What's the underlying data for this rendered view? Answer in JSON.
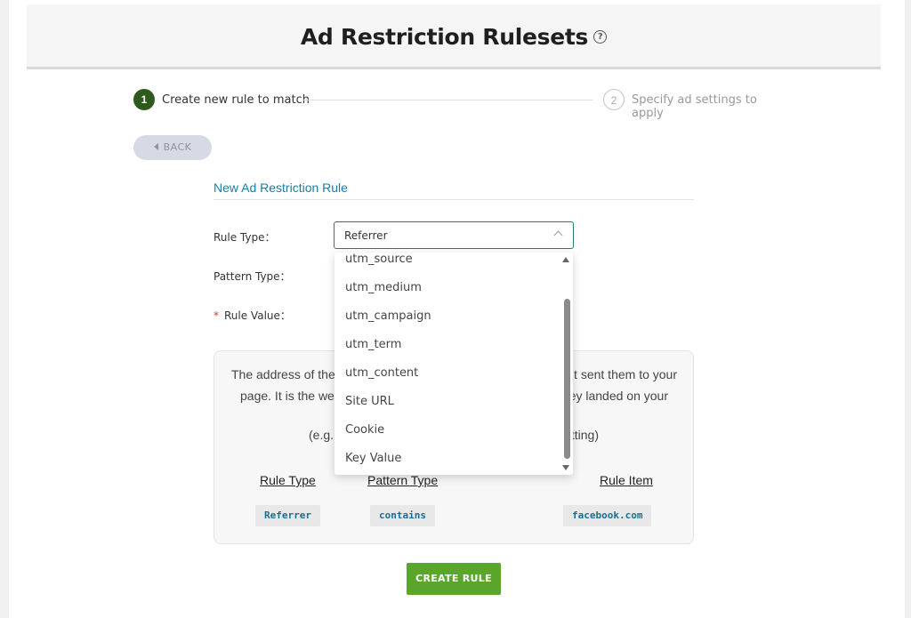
{
  "header": {
    "title": "Ad Restriction Rulesets",
    "help_icon": "?"
  },
  "stepper": {
    "step1": {
      "number": "1",
      "label": "Create new rule to match"
    },
    "step2": {
      "number": "2",
      "label": "Specify ad settings to apply"
    }
  },
  "back_button": {
    "label": "BACK"
  },
  "form": {
    "section_title": "New Ad Restriction Rule",
    "rule_type_label": "Rule Type：",
    "pattern_type_label": "Pattern Type：",
    "rule_value_label": "Rule Value：",
    "required_marker": "*",
    "rule_type_selected": "Referrer"
  },
  "dropdown": {
    "options": [
      "utm_source",
      "utm_medium",
      "utm_campaign",
      "utm_term",
      "utm_content",
      "Site URL",
      "Cookie",
      "Key Value"
    ]
  },
  "example": {
    "line1_left": "The address of the",
    "line1_right": "t sent them to your",
    "line2_left": "page. It is the we",
    "line2_right": "ey landed on your",
    "eg_left": "(e.g.",
    "eg_right": "tting)",
    "col_rule_type": "Rule Type",
    "col_pattern_type": "Pattern Type",
    "col_rule_item": "Rule Item",
    "chip_rule_type": "Referrer",
    "chip_pattern_type": "contains",
    "chip_rule_item": "facebook.com"
  },
  "create_button": {
    "label": "CREATE RULE"
  },
  "colors": {
    "accent_green": "#5aa62c",
    "step_active": "#2f5a1e",
    "link_blue": "#1a7ca6",
    "required_red": "#d9363e"
  }
}
